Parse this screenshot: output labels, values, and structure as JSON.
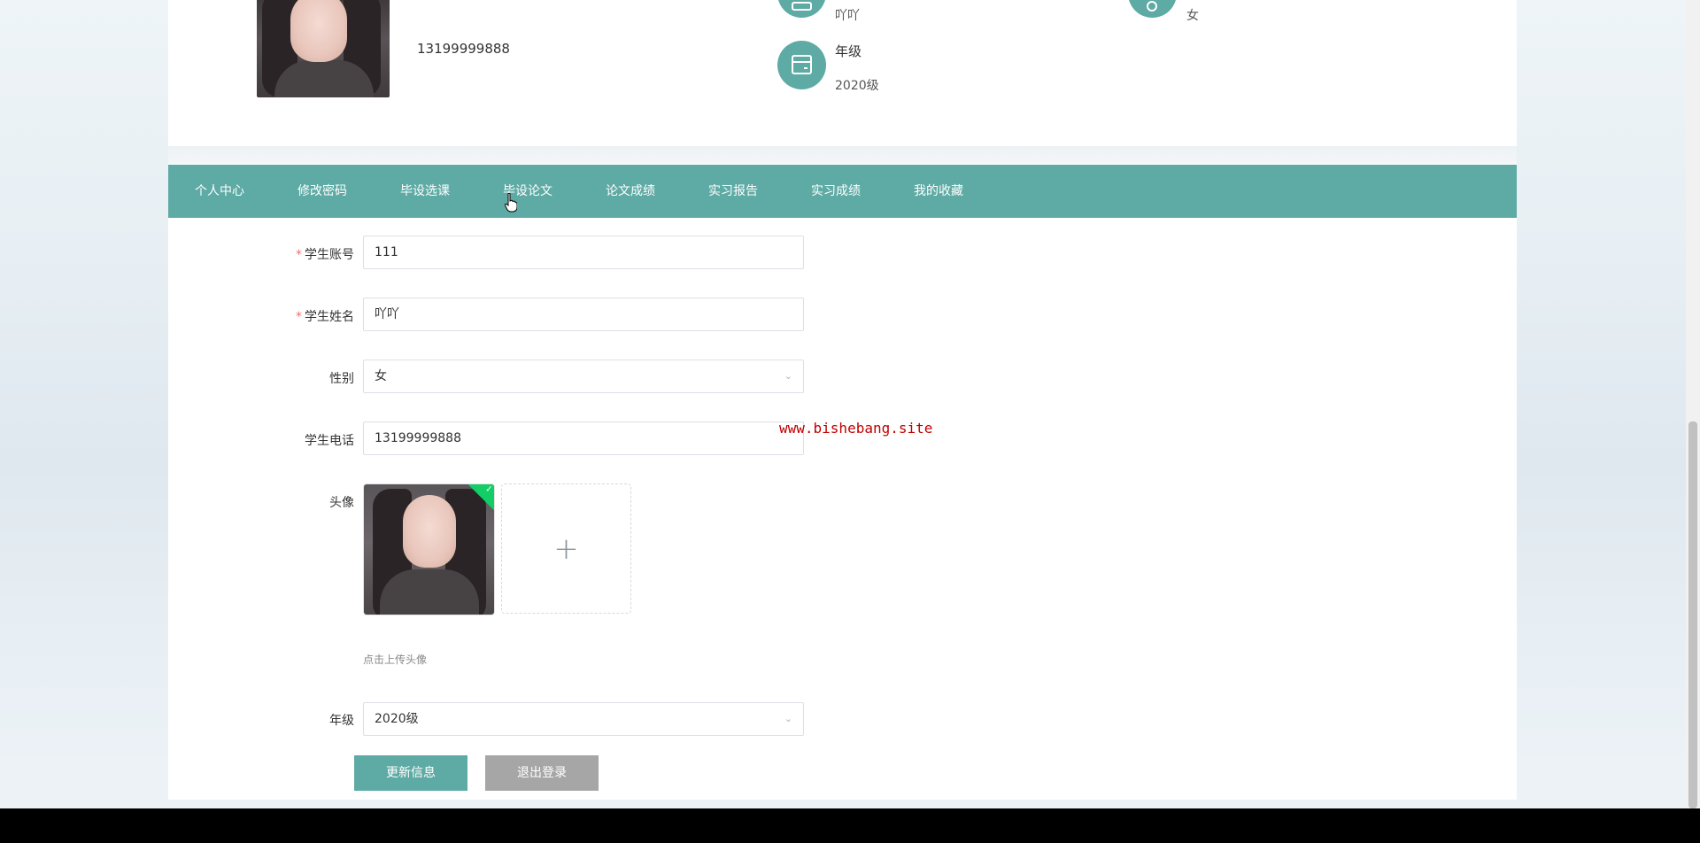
{
  "profile": {
    "phone": "13199999888",
    "name_value": "吖吖",
    "gender_value": "女",
    "grade_label": "年级",
    "grade_value": "2020级"
  },
  "nav": {
    "items": [
      "个人中心",
      "修改密码",
      "毕设选课",
      "毕设论文",
      "论文成绩",
      "实习报告",
      "实习成绩",
      "我的收藏"
    ]
  },
  "form": {
    "account": {
      "label": "学生账号",
      "value": "111",
      "required": "*"
    },
    "name": {
      "label": "学生姓名",
      "value": "吖吖",
      "required": "*"
    },
    "gender": {
      "label": "性别",
      "value": "女"
    },
    "phone": {
      "label": "学生电话",
      "value": "13199999888"
    },
    "avatar": {
      "label": "头像",
      "tip": "点击上传头像",
      "add_symbol": "+"
    },
    "grade": {
      "label": "年级",
      "value": "2020级"
    }
  },
  "buttons": {
    "update": "更新信息",
    "logout": "退出登录"
  },
  "watermark": "www.bishebang.site",
  "colors": {
    "accent": "#5eaaa4",
    "logout_button": "#a6a6a6",
    "required": "#f56c6c",
    "success": "#13ce66",
    "watermark": "#c00000"
  },
  "icons": {
    "grade": "wallet-icon",
    "name": "user-icon",
    "gender": "gender-icon"
  }
}
